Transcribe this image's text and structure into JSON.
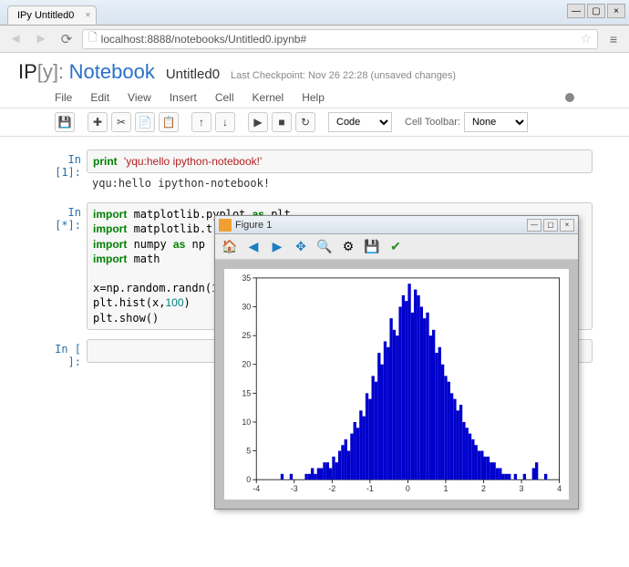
{
  "browser": {
    "tab_title": "IPy Untitled0",
    "url": "localhost:8888/notebooks/Untitled0.ipynb#"
  },
  "notebook": {
    "logo_ip": "IP",
    "logo_y": "y",
    "logo_nb": "Notebook",
    "title": "Untitled0",
    "checkpoint": "Last Checkpoint: Nov 26 22:28 (unsaved changes)"
  },
  "menus": {
    "file": "File",
    "edit": "Edit",
    "view": "View",
    "insert": "Insert",
    "cell": "Cell",
    "kernel": "Kernel",
    "help": "Help"
  },
  "toolbar": {
    "celltype": "Code",
    "celltoolbar_label": "Cell Toolbar:",
    "celltoolbar_value": "None"
  },
  "cells": [
    {
      "prompt": "In [1]:",
      "code": {
        "kw1": "print",
        "str": "'yqu:hello ipython-notebook!'"
      },
      "output": "yqu:hello ipython-notebook!"
    },
    {
      "prompt": "In [*]:",
      "code_lines": [
        "import matplotlib.pyplot as plt",
        "import matplotlib.tri as tri",
        "import numpy as np",
        "import math",
        "",
        "x=np.random.randn(1000)",
        "plt.hist(x,100)",
        "plt.show()"
      ]
    },
    {
      "prompt": "In [ ]:",
      "code_lines": [
        ""
      ]
    }
  ],
  "figure": {
    "title": "Figure 1"
  },
  "chart_data": {
    "type": "bar",
    "title": "",
    "xlabel": "",
    "ylabel": "",
    "xlim": [
      -4,
      4
    ],
    "ylim": [
      0,
      35
    ],
    "xticks": [
      -4,
      -3,
      -2,
      -1,
      0,
      1,
      2,
      3,
      4
    ],
    "yticks": [
      0,
      5,
      10,
      15,
      20,
      25,
      30,
      35
    ],
    "bin_edges_start": -4,
    "bin_width": 0.08,
    "values": [
      0,
      0,
      0,
      0,
      0,
      0,
      0,
      0,
      1,
      0,
      0,
      1,
      0,
      0,
      0,
      0,
      1,
      1,
      2,
      1,
      2,
      2,
      3,
      3,
      2,
      4,
      3,
      5,
      6,
      7,
      5,
      8,
      10,
      9,
      12,
      11,
      15,
      14,
      18,
      17,
      22,
      20,
      24,
      23,
      28,
      26,
      25,
      30,
      32,
      31,
      34,
      29,
      33,
      32,
      30,
      28,
      29,
      25,
      26,
      22,
      23,
      20,
      18,
      17,
      15,
      14,
      12,
      13,
      10,
      9,
      8,
      7,
      6,
      5,
      5,
      4,
      4,
      3,
      3,
      2,
      2,
      1,
      1,
      1,
      0,
      1,
      0,
      0,
      1,
      0,
      0,
      2,
      3,
      0,
      0,
      1,
      0,
      0,
      0,
      0
    ]
  }
}
